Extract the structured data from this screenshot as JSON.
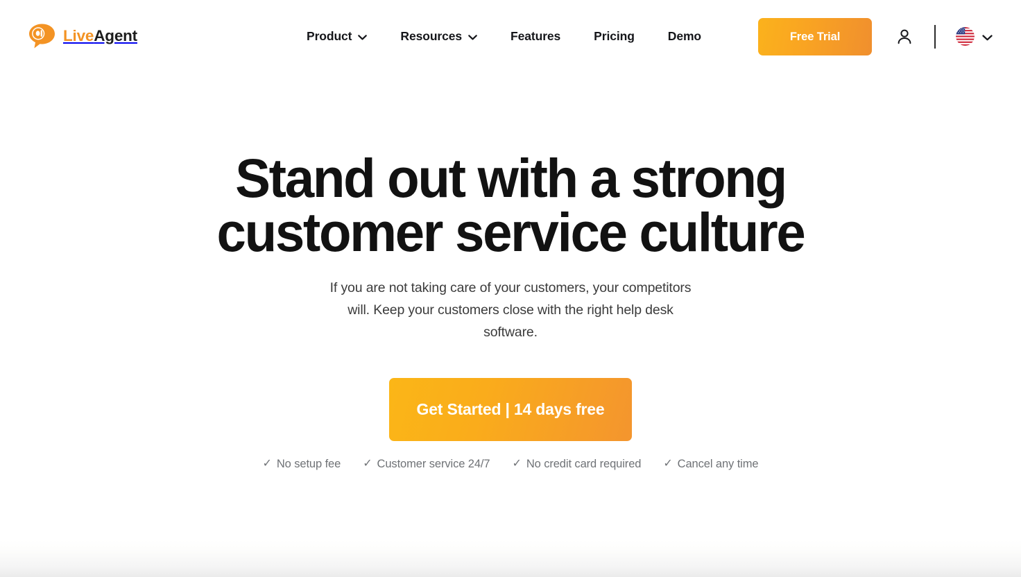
{
  "brand": {
    "logo_live": "Live",
    "logo_agent": "Agent",
    "logo_icon": "at-speech-bubble-icon",
    "accent_orange": "#F39324",
    "cta_gradient_from": "#FBB617",
    "cta_gradient_to": "#F4952E"
  },
  "header": {
    "nav": [
      {
        "label": "Product",
        "has_dropdown": true,
        "icon": "chevron-down-icon"
      },
      {
        "label": "Resources",
        "has_dropdown": true,
        "icon": "chevron-down-icon"
      },
      {
        "label": "Features",
        "has_dropdown": false,
        "icon": ""
      },
      {
        "label": "Pricing",
        "has_dropdown": false,
        "icon": ""
      },
      {
        "label": "Demo",
        "has_dropdown": false,
        "icon": ""
      }
    ],
    "free_trial_label": "Free Trial",
    "account_icon": "user-account-icon",
    "language_flag": "us-flag-icon",
    "language_chevron": "chevron-down-icon"
  },
  "hero": {
    "title_line1": "Stand out with a strong",
    "title_line2": "customer service culture",
    "subtitle": "If you are not taking care of your customers, your competitors will. Keep your customers close with the right help desk software.",
    "cta_label": "Get Started | 14 days free",
    "perks": [
      {
        "check": "✓",
        "label": "No setup fee"
      },
      {
        "check": "✓",
        "label": "Customer service 24/7"
      },
      {
        "check": "✓",
        "label": "No credit card required"
      },
      {
        "check": "✓",
        "label": "Cancel any time"
      }
    ]
  }
}
